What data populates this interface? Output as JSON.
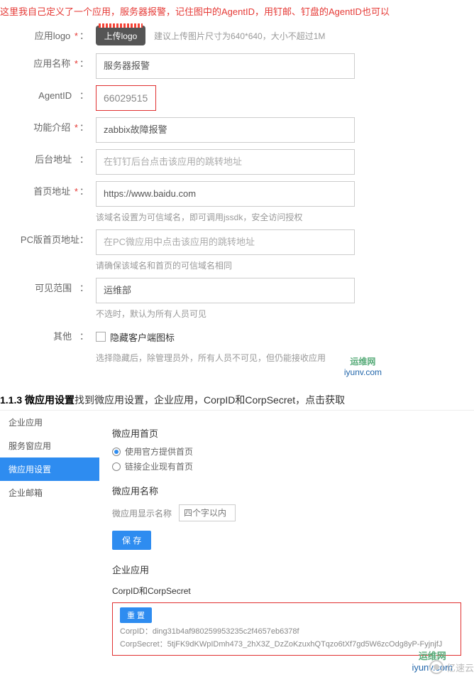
{
  "intro": "这里我自己定义了一个应用，服务器报警，记住图中的AgentID，用钉邮、钉盘的AgentID也可以",
  "form": {
    "logo": {
      "label": "应用logo",
      "button": "上传logo",
      "hint": "建议上传图片尺寸为640*640，大小不超过1M"
    },
    "name": {
      "label": "应用名称",
      "value": "服务器报警"
    },
    "agentid": {
      "label": "AgentID",
      "value": "66029515"
    },
    "feature": {
      "label": "功能介绍",
      "value": "zabbix故障报警"
    },
    "backend": {
      "label": "后台地址",
      "placeholder": "在钉钉后台点击该应用的跳转地址"
    },
    "homepage": {
      "label": "首页地址",
      "value": "https://www.baidu.com",
      "hint": "该域名设置为可信域名，即可调用jssdk，安全访问授权"
    },
    "pcurl": {
      "label": "PC版首页地址",
      "placeholder": "在PC微应用中点击该应用的跳转地址",
      "hint2": "请确保该域名和首页的可信域名相同"
    },
    "scope": {
      "label": "可见范围",
      "value": "运维部",
      "hint": "不选时，默认为所有人员可见"
    },
    "other": {
      "label": "其他",
      "checkbox": "隐藏客户端图标",
      "hint": "选择隐藏后，除管理员外，所有人员不可见，但仍能接收应用"
    }
  },
  "watermark1": {
    "t1": "运维网",
    "t2": "iyunv.com"
  },
  "section2": {
    "num": "1.1.3 微应用设置",
    "text": "找到微应用设置，企业应用，CorpID和CorpSecret，点击获取"
  },
  "sidebar": [
    "企业应用",
    "服务窗应用",
    "微应用设置",
    "企业邮箱"
  ],
  "micro": {
    "homeTitle": "微应用首页",
    "radio1": "使用官方提供首页",
    "radio2": "链接企业现有首页",
    "nameTitle": "微应用名称",
    "nameSub": "微应用显示名称",
    "namePh": "四个字以内",
    "save": "保 存",
    "corpTitle": "企业应用",
    "corpSub": "CorpID和CorpSecret",
    "btn": "重 置",
    "corpid": "CorpID：ding31b4af980259953235c2f4657eb6378f",
    "corpsecret": "CorpSecret：5tjFK9dKWpIDmh473_2hX3Z_DzZoKzuxhQTqzo6tXf7gd5W6zcOdg8yP-FyjnjfJ"
  },
  "watermark2": {
    "t1": "运维网",
    "t2": "iyunv.com"
  },
  "yisu": "亿速云"
}
